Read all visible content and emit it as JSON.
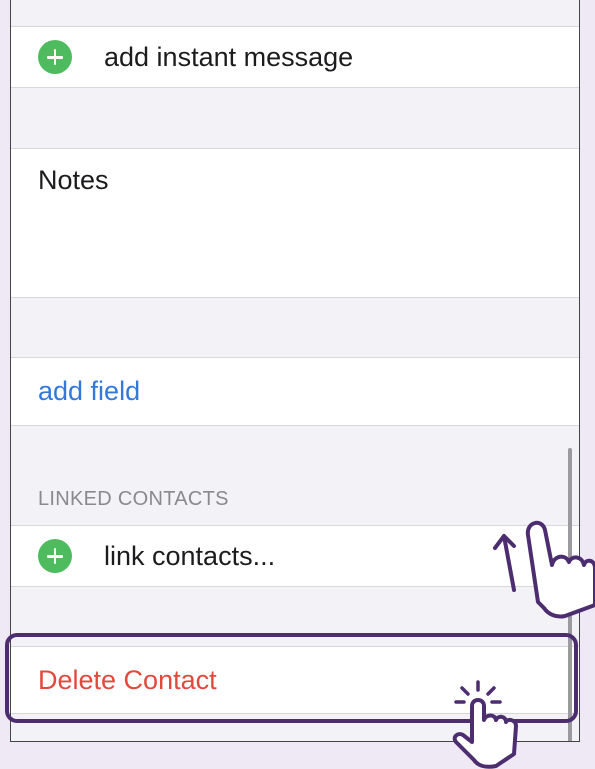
{
  "contact_edit": {
    "add_instant_message_label": "add instant message",
    "notes_label": "Notes",
    "add_field_label": "add field",
    "linked_contacts_header": "LINKED CONTACTS",
    "link_contacts_label": "link contacts...",
    "delete_contact_label": "Delete Contact"
  },
  "icons": {
    "add": "plus-circle-icon",
    "swipe_gesture": "swipe-up-hand-icon",
    "tap_gesture": "tap-hand-icon"
  },
  "colors": {
    "add_green": "#4fbb5f",
    "link_blue": "#3478db",
    "destructive_red": "#e2493d",
    "highlight_purple": "#4c2d6f",
    "background": "#efe9f6"
  }
}
